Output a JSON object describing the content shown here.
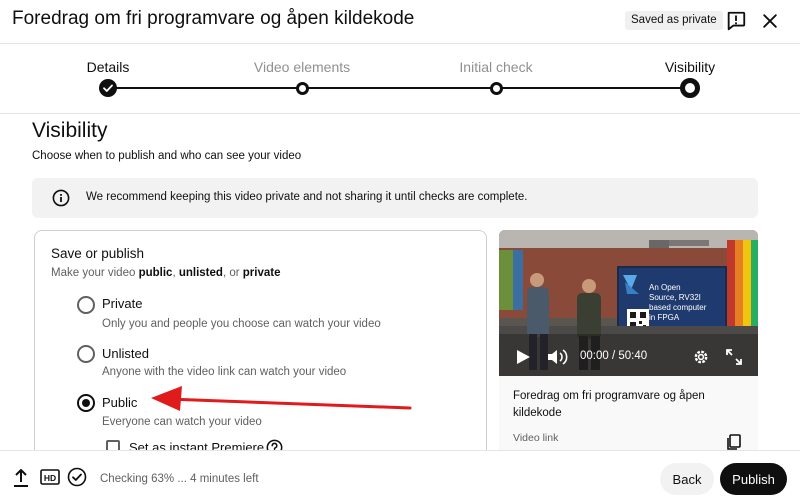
{
  "header": {
    "title": "Foredrag om fri programvare og åpen kildekode",
    "saved_badge": "Saved as private",
    "feedback_icon": "feedback-icon",
    "close_icon": "close-icon"
  },
  "stepper": {
    "steps": [
      {
        "label": "Details",
        "state": "completed"
      },
      {
        "label": "Video elements",
        "state": "pending"
      },
      {
        "label": "Initial check",
        "state": "pending"
      },
      {
        "label": "Visibility",
        "state": "current"
      }
    ]
  },
  "visibility": {
    "heading": "Visibility",
    "subtitle": "Choose when to publish and who can see your video",
    "info_text": "We recommend keeping this video private and not sharing it until checks are complete."
  },
  "save_publish": {
    "title": "Save or publish",
    "subtitle_prefix": "Make your video ",
    "subtitle_public": "public",
    "subtitle_sep1": ", ",
    "subtitle_unlisted": "unlisted",
    "subtitle_sep2": ", or ",
    "subtitle_private": "private",
    "options": [
      {
        "label": "Private",
        "description": "Only you and people you choose can watch your video",
        "selected": false
      },
      {
        "label": "Unlisted",
        "description": "Anyone with the video link can watch your video",
        "selected": false
      },
      {
        "label": "Public",
        "description": "Everyone can watch your video",
        "selected": true
      }
    ],
    "premiere_label": "Set as instant Premiere",
    "premiere_checked": false
  },
  "video_preview": {
    "slide_text": "An Open Source, RV32I based computer in FPGA",
    "time": "00:00 / 50:40",
    "title": "Foredrag om fri programvare og åpen kildekode",
    "link_label": "Video link"
  },
  "footer": {
    "status_text": "Checking 63% ... 4 minutes left",
    "check_progress": 0.63,
    "back_label": "Back",
    "publish_label": "Publish"
  },
  "colors": {
    "annotation_arrow": "#e01b1b",
    "primary_button": "#0f0f0f"
  }
}
